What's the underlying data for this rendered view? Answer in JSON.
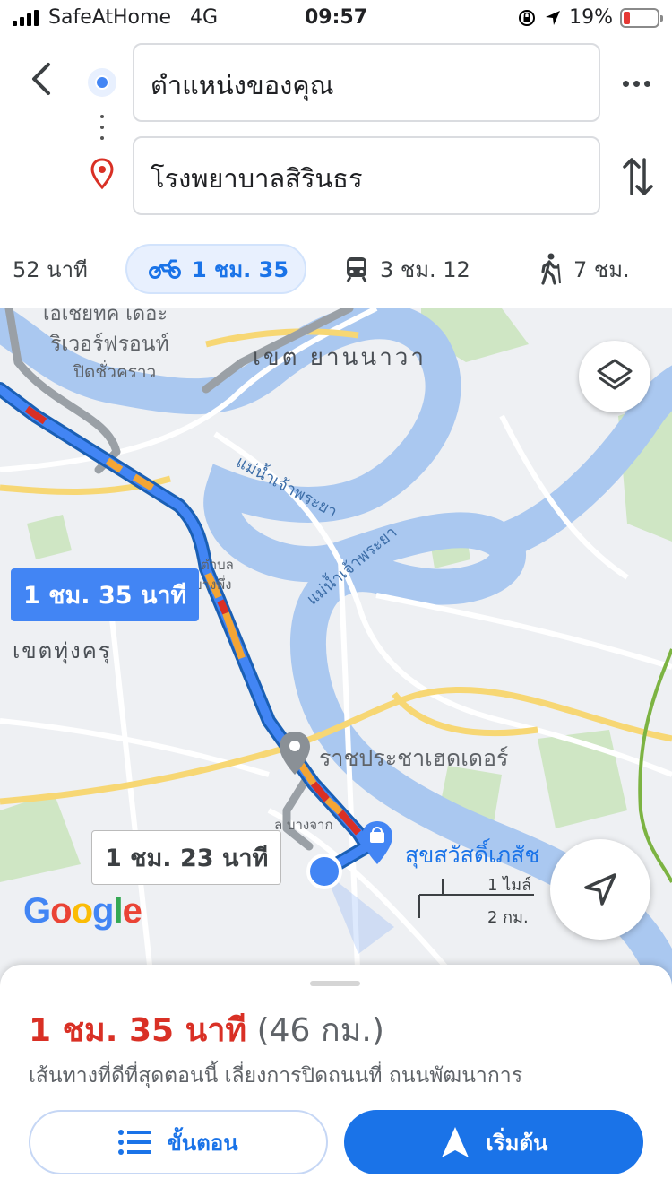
{
  "status_bar": {
    "carrier": "SafeAtHome",
    "network": "4G",
    "time": "09:57",
    "battery": "19%",
    "battery_level": 0.19,
    "icons": [
      "signal-icon",
      "rotation-lock-icon",
      "location-arrow-icon",
      "battery-icon"
    ]
  },
  "route_header": {
    "origin": "ตำแหน่งของคุณ",
    "destination": "โรงพยาบาลสิรินธร",
    "icons": [
      "back-icon",
      "origin-dot-icon",
      "destination-pin-icon",
      "more-icon",
      "swap-icon"
    ]
  },
  "travel_modes": [
    {
      "mode": "car",
      "label": "52 นาที",
      "selected": false
    },
    {
      "mode": "motorcycle",
      "icon": "motorcycle-icon",
      "label": "1 ชม. 35",
      "selected": true
    },
    {
      "mode": "transit",
      "icon": "train-icon",
      "label": "3 ชม. 12",
      "selected": false
    },
    {
      "mode": "walk",
      "icon": "walking-icon",
      "label": "7 ชม.",
      "selected": false
    }
  ],
  "map": {
    "labels": {
      "district_1_line1": "เอเชียทีค เดอะ",
      "district_1_line2": "ริเวอร์ฟรอนท์",
      "district_1_line3": "ปิดชั่วคราว",
      "yannawa": "เขต ยานนาวา",
      "river_1": "แม่น้ำเจ้าพระยา",
      "river_2": "แม่น้ำเจ้าพระยา",
      "bang_phueng_1": "ตำบล",
      "bang_phueng_2": "บางพึ่ง",
      "thung_khru": "เขตทุ่งครุ",
      "bang_chak": "ล บางจาก"
    },
    "primary_route_time": "1 ชม. 35 นาที",
    "alt_route_time": "1 ชม. 23 นาที",
    "places": [
      {
        "name": "ราชประชาเฮดเดอร์",
        "color": "#5f6368"
      },
      {
        "name": "สุขสวัสดิ์เภสัช",
        "color": "#1a73e8"
      }
    ],
    "scale_top": "1 ไมล์",
    "scale_bottom": "2 กม.",
    "logo": "Google",
    "colors": {
      "route": "#4285f4",
      "traffic_slow": "#f4a534",
      "traffic_jam": "#d93025",
      "water": "#aac8f0",
      "road": "#ffffff",
      "highway": "#f7d774"
    }
  },
  "bottom_sheet": {
    "duration": "1 ชม. 35 นาที",
    "distance": "(46 กม.)",
    "description": "เส้นทางที่ดีที่สุดตอนนี้ เลี่ยงการปิดถนนที่ ถนนพัฒนาการ",
    "steps_label": "ขั้นตอน",
    "start_label": "เริ่มต้น"
  }
}
